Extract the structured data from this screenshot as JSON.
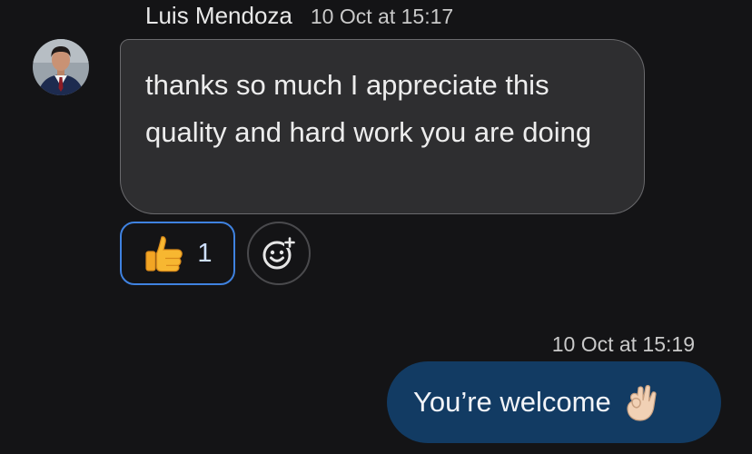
{
  "incoming": {
    "sender_name": "Luis Mendoza",
    "timestamp": "10 Oct at 15:17",
    "message": "thanks so much I appreciate this quality and hard work you are doing",
    "avatar_icon": "person-avatar-icon"
  },
  "reactions": {
    "thumbs_up": {
      "icon": "thumbs-up-emoji",
      "count": "1",
      "accent": "#3f82e0"
    },
    "add_reaction_icon": "add-reaction-smiley-icon"
  },
  "outgoing": {
    "timestamp": "10 Oct at 15:19",
    "message": "You’re welcome",
    "emoji_icon": "ok-hand-emoji",
    "bubble_color": "#123b63"
  }
}
